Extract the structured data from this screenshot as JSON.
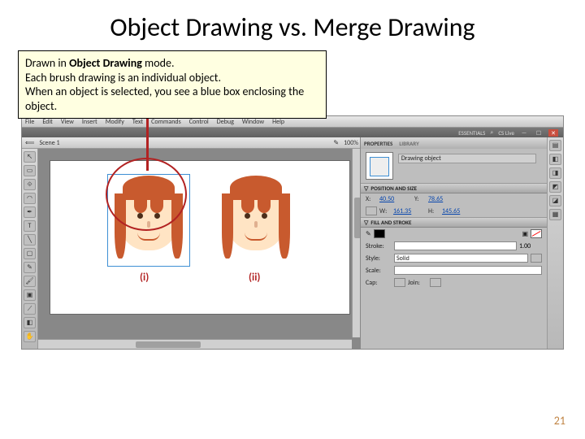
{
  "title": "Object Drawing vs. Merge Drawing",
  "callout": {
    "line1_pre": "Drawn in ",
    "line1_bold": "Object Drawing",
    "line1_post": " mode.",
    "line2": "Each  brush drawing is an individual object.",
    "line3": "When an object is selected, you see a blue box enclosing the object."
  },
  "menubar": [
    "File",
    "Edit",
    "View",
    "Insert",
    "Modify",
    "Text",
    "Commands",
    "Control",
    "Debug",
    "Window",
    "Help"
  ],
  "topband": {
    "essentials": "ESSENTIALS",
    "cs": "CS Live"
  },
  "scene": {
    "name": "Scene 1",
    "zoom": "100%"
  },
  "figures": {
    "i": "(i)",
    "ii": "(ii)"
  },
  "panel": {
    "tab1": "PROPERTIES",
    "tab2": "LIBRARY",
    "objlabel": "Drawing object",
    "pos_hdr": "POSITION AND SIZE",
    "x_lbl": "X:",
    "x_val": "40.50",
    "y_lbl": "Y:",
    "y_val": "78.65",
    "w_lbl": "W:",
    "w_val": "161.35",
    "h_lbl": "H:",
    "h_val": "145.65",
    "fill_hdr": "FILL AND STROKE",
    "stroke_lbl": "Stroke:",
    "stroke_val": "1.00",
    "style_lbl": "Style:",
    "style_val": "Solid",
    "scale_lbl": "Scale:",
    "cap_lbl": "Cap:",
    "join_lbl": "Join:"
  },
  "pagenum": "21"
}
